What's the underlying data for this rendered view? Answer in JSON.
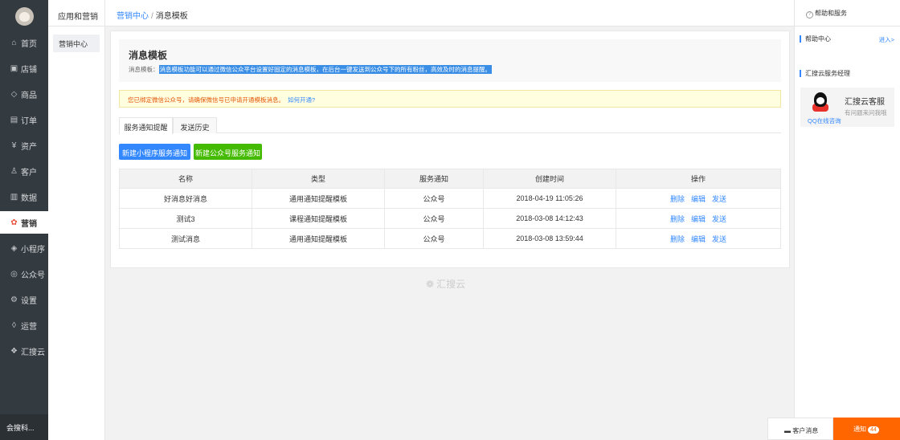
{
  "sidebar": {
    "items": [
      {
        "label": "首页",
        "icon": "⌂",
        "name": "home"
      },
      {
        "label": "店铺",
        "icon": "▣",
        "name": "store"
      },
      {
        "label": "商品",
        "icon": "◇",
        "name": "goods"
      },
      {
        "label": "订单",
        "icon": "▤",
        "name": "orders"
      },
      {
        "label": "资产",
        "icon": "¥",
        "name": "assets"
      },
      {
        "label": "客户",
        "icon": "♙",
        "name": "customers"
      },
      {
        "label": "数据",
        "icon": "▥",
        "name": "data"
      },
      {
        "label": "营销",
        "icon": "✿",
        "name": "marketing"
      },
      {
        "label": "小程序",
        "icon": "◈",
        "name": "miniprogram"
      },
      {
        "label": "公众号",
        "icon": "◎",
        "name": "official-account"
      },
      {
        "label": "设置",
        "icon": "⚙",
        "name": "settings"
      },
      {
        "label": "运营",
        "icon": "◊",
        "name": "operations"
      },
      {
        "label": "汇搜云",
        "icon": "❖",
        "name": "huisouyun"
      }
    ],
    "bottom_label": "会搜科..."
  },
  "subnav": {
    "title": "应用和营销",
    "item": "营销中心"
  },
  "breadcrumb": {
    "parent": "营销中心",
    "sep": "/",
    "current": "消息模板"
  },
  "intro": {
    "title": "消息模板",
    "prefix": "消息模板：",
    "text": "消息模板功能可以通过微信公众平台设置好固定的消息模板，在后台一键发送到公众号下的所有粉丝，高效及时的消息提醒。"
  },
  "notice": {
    "text": "您已绑定微信公众号，请确保微信号已申请开通模板消息。",
    "link": "如何开通?"
  },
  "tabs": [
    "服务通知提醒",
    "发送历史"
  ],
  "buttons": {
    "new_mini": "新建小程序服务通知",
    "new_oa": "新建公众号服务通知"
  },
  "table": {
    "headers": [
      "名称",
      "类型",
      "服务通知",
      "创建时间",
      "操作"
    ],
    "rows": [
      {
        "name": "好消息好消息",
        "type": "通用通知提醒模板",
        "service": "公众号",
        "created": "2018-04-19 11:05:26"
      },
      {
        "name": "测试3",
        "type": "课程通知提醒模板",
        "service": "公众号",
        "created": "2018-03-08 14:12:43"
      },
      {
        "name": "测试消息",
        "type": "通用通知提醒模板",
        "service": "公众号",
        "created": "2018-03-08 13:59:44"
      }
    ],
    "ops": {
      "delete": "删除",
      "edit": "编辑",
      "send": "发送"
    }
  },
  "watermark": "汇搜云",
  "right_panel": {
    "title": "帮助和服务",
    "help_center": "帮助中心",
    "enter": "进入>",
    "manager": "汇搜云服务经理",
    "service_name": "汇搜云客服",
    "service_sub": "有问题来问我哦",
    "qq_link": "QQ在线咨询"
  },
  "footer": {
    "messages": "客户消息",
    "notify": "通知",
    "notify_count": "44"
  },
  "colors": {
    "accent": "#3388ff",
    "green": "#44bb00",
    "orange": "#ff6600",
    "nav_bg": "#333a40"
  }
}
